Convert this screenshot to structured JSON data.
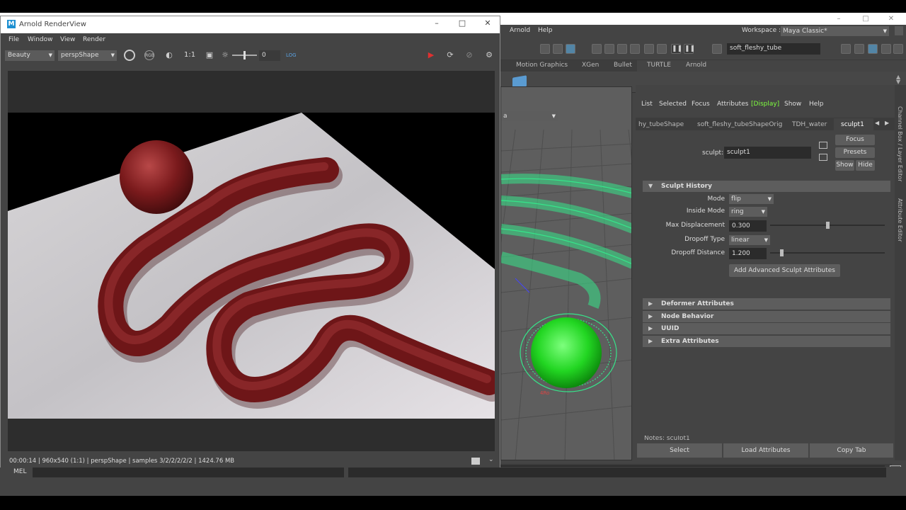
{
  "maya": {
    "menu": [
      "Arnold",
      "Help"
    ],
    "workspace_label": "Workspace :",
    "workspace_value": "Maya Classic*",
    "object_field": "soft_fleshy_tube",
    "shelf_tabs": [
      "Motion Graphics",
      "XGen",
      "Bullet",
      "TURTLE",
      "Arnold"
    ],
    "viewport_dropdown": "a",
    "viewport_axis": "4Ro"
  },
  "attribute_editor": {
    "menu": [
      "List",
      "Selected",
      "Focus",
      "Attributes",
      "[Display]",
      "Show",
      "Help"
    ],
    "tabs": [
      "hy_tubeShape",
      "soft_fleshy_tubeShapeOrig",
      "TDH_water",
      "sculpt1"
    ],
    "node_label": "sculpt:",
    "node_value": "sculpt1",
    "buttons": {
      "focus": "Focus",
      "presets": "Presets",
      "show": "Show",
      "hide": "Hide"
    },
    "section_title": "Sculpt History",
    "attrs": {
      "mode_label": "Mode",
      "mode_value": "flip",
      "inside_mode_label": "Inside Mode",
      "inside_mode_value": "ring",
      "max_disp_label": "Max Displacement",
      "max_disp_value": "0.300",
      "dropoff_type_label": "Dropoff Type",
      "dropoff_type_value": "linear",
      "dropoff_dist_label": "Dropoff Distance",
      "dropoff_dist_value": "1.200"
    },
    "max_disp_slider_fraction": 0.5,
    "dropoff_dist_slider_fraction": 0.1,
    "add_advanced": "Add Advanced Sculpt Attributes",
    "collapsed_sections": [
      "Deformer Attributes",
      "Node Behavior",
      "UUID",
      "Extra Attributes"
    ],
    "notes_partial": "Notes: sculpt1",
    "bottom_buttons": [
      "Select",
      "Load Attributes",
      "Copy Tab"
    ],
    "side_tabs": [
      "Channel Box / Layer Editor",
      "Attribute Editor"
    ]
  },
  "renderview": {
    "title": "Arnold RenderView",
    "menu": [
      "File",
      "Window",
      "View",
      "Render"
    ],
    "aov": "Beauty",
    "camera": "perspShape",
    "ratio": "1:1",
    "exposure": "0",
    "status": "00:00:14 | 960x540 (1:1) | perspShape  | samples 3/2/2/2/2/2 | 1424.76 MB"
  },
  "mel": {
    "label": "MEL"
  },
  "colors": {
    "wire": "#36e58a",
    "sphere": "#22d622",
    "tube": "#7a1a1c",
    "accent_blue": "#5285a6"
  }
}
